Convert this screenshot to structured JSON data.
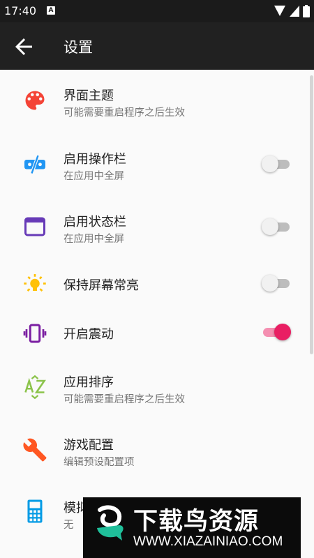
{
  "status_bar": {
    "time": "17:40",
    "notification_letter": "A"
  },
  "app_bar": {
    "title": "设置"
  },
  "items": [
    {
      "title": "界面主题",
      "subtitle": "可能需要重启程序之后生效",
      "icon": "palette-icon",
      "color": "#f44336"
    },
    {
      "title": "启用操作栏",
      "subtitle": "在应用中全屏",
      "icon": "toolbar-off-icon",
      "color": "#2196f3",
      "toggle": false
    },
    {
      "title": "启用状态栏",
      "subtitle": "在应用中全屏",
      "icon": "window-icon",
      "color": "#673ab7",
      "toggle": false
    },
    {
      "title": "保持屏幕常亮",
      "icon": "light-bulb-icon",
      "color": "#ffc107",
      "toggle": false
    },
    {
      "title": "开启震动",
      "icon": "vibration-icon",
      "color": "#7b1fa2",
      "toggle": true
    },
    {
      "title": "应用排序",
      "subtitle": "可能需要重启程序之后生效",
      "icon": "sort-az-icon",
      "color": "#8bc34a"
    },
    {
      "title": "游戏配置",
      "subtitle": "编辑预设配置项",
      "icon": "wrench-icon",
      "color": "#ff5722"
    },
    {
      "title": "模拟",
      "subtitle": "无",
      "icon": "calculator-icon",
      "color": "#039be5"
    }
  ],
  "watermark": {
    "title": "下载鸟资源",
    "url": "WWW.XIAZAINIAO.COM"
  }
}
